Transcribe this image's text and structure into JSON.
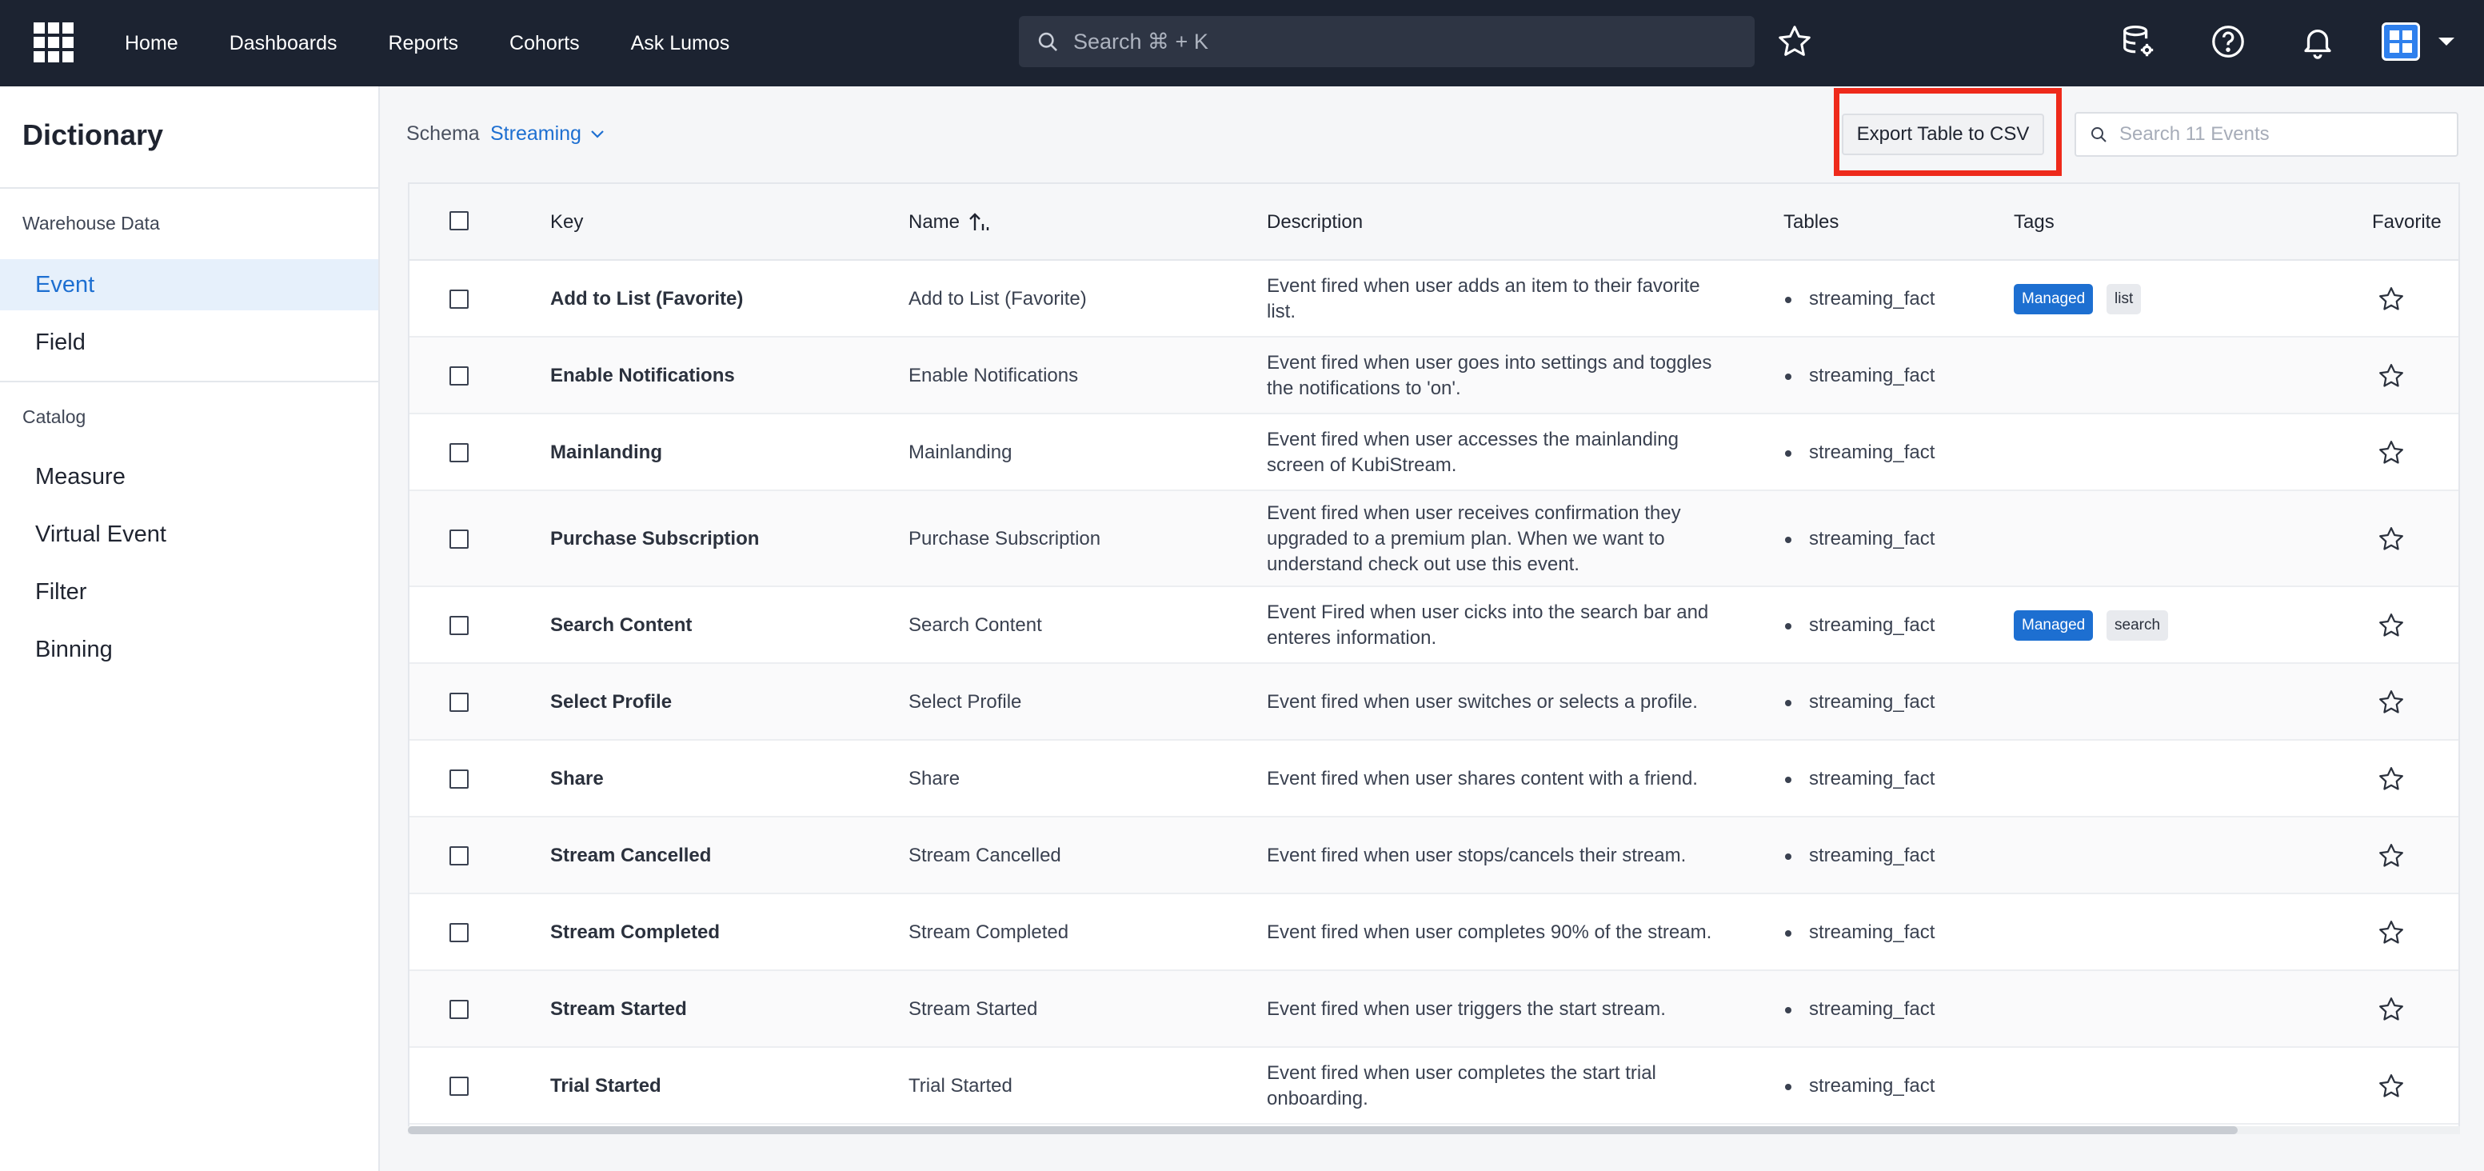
{
  "nav": {
    "items": [
      {
        "label": "Home"
      },
      {
        "label": "Dashboards"
      },
      {
        "label": "Reports"
      },
      {
        "label": "Cohorts"
      },
      {
        "label": "Ask Lumos"
      }
    ],
    "search_placeholder": "Search ⌘ + K",
    "icons": [
      "app-grid-icon",
      "search-icon",
      "star-icon",
      "database-settings-icon",
      "help-icon",
      "bell-icon",
      "user-avatar",
      "chevron-down-icon"
    ]
  },
  "sidebar": {
    "title": "Dictionary",
    "sections": [
      {
        "label": "Warehouse Data",
        "items": [
          {
            "label": "Event",
            "active": true
          },
          {
            "label": "Field",
            "active": false
          }
        ]
      },
      {
        "label": "Catalog",
        "items": [
          {
            "label": "Measure"
          },
          {
            "label": "Virtual Event"
          },
          {
            "label": "Filter"
          },
          {
            "label": "Binning"
          }
        ]
      }
    ]
  },
  "toolbar": {
    "schema_label": "Schema",
    "schema_value": "Streaming",
    "export_label": "Export Table to CSV",
    "search_placeholder": "Search 11 Events"
  },
  "table": {
    "columns": [
      "Key",
      "Name",
      "Description",
      "Tables",
      "Tags",
      "Favorite"
    ],
    "rows": [
      {
        "key": "Add to List (Favorite)",
        "name": "Add to List (Favorite)",
        "description": "Event fired when user adds an item to their favorite list.",
        "table": "streaming_fact",
        "tags": [
          "Managed",
          "list"
        ]
      },
      {
        "key": "Enable Notifications",
        "name": "Enable Notifications",
        "description": "Event fired when user goes into settings and toggles the notifications to 'on'.",
        "table": "streaming_fact",
        "tags": []
      },
      {
        "key": "Mainlanding",
        "name": "Mainlanding",
        "description": "Event fired when user accesses the mainlanding screen of KubiStream.",
        "table": "streaming_fact",
        "tags": []
      },
      {
        "key": "Purchase Subscription",
        "name": "Purchase Subscription",
        "description": "Event fired when user receives confirmation they upgraded to a premium plan. When we want to understand check out use this event.",
        "table": "streaming_fact",
        "tags": []
      },
      {
        "key": "Search Content",
        "name": "Search Content",
        "description": "Event Fired when user cicks into the search bar and enteres information.",
        "table": "streaming_fact",
        "tags": [
          "Managed",
          "search"
        ]
      },
      {
        "key": "Select Profile",
        "name": "Select Profile",
        "description": "Event fired when user switches or selects a profile.",
        "table": "streaming_fact",
        "tags": []
      },
      {
        "key": "Share",
        "name": "Share",
        "description": "Event fired when user shares content with a friend.",
        "table": "streaming_fact",
        "tags": []
      },
      {
        "key": "Stream Cancelled",
        "name": "Stream Cancelled",
        "description": "Event fired when user stops/cancels their stream.",
        "table": "streaming_fact",
        "tags": []
      },
      {
        "key": "Stream Completed",
        "name": "Stream Completed",
        "description": "Event fired when user completes 90% of the stream.",
        "table": "streaming_fact",
        "tags": []
      },
      {
        "key": "Stream Started",
        "name": "Stream Started",
        "description": "Event fired when user triggers the start stream.",
        "table": "streaming_fact",
        "tags": []
      },
      {
        "key": "Trial Started",
        "name": "Trial Started",
        "description": "Event fired when user completes the start trial onboarding.",
        "table": "streaming_fact",
        "tags": []
      }
    ]
  },
  "colors": {
    "topbar": "#1c2331",
    "accent": "#1d6fd1",
    "highlight": "#ee2a1b"
  }
}
